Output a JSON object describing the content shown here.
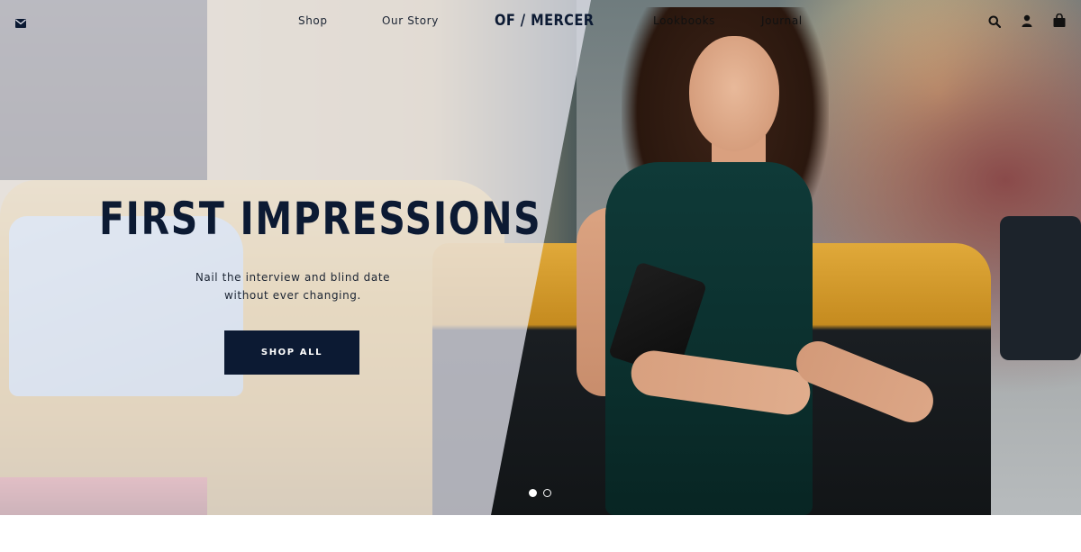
{
  "header": {
    "nav": {
      "shop": "Shop",
      "our_story": "Our Story",
      "lookbooks": "Lookbooks",
      "journal": "Journal"
    },
    "logo": "OF / MERCER",
    "icons": {
      "mail": "mail-icon",
      "search": "search-icon",
      "account": "user-icon",
      "cart": "bag-icon"
    }
  },
  "hero": {
    "headline": "FIRST IMPRESSIONS",
    "subline": [
      "Nail the interview and blind date",
      "without ever changing."
    ],
    "cta_label": "SHOP ALL",
    "slides": {
      "count": 2,
      "active": 1
    }
  },
  "colors": {
    "navy": "#0c1a33",
    "overlay": "#ecedf5",
    "white": "#ffffff"
  }
}
